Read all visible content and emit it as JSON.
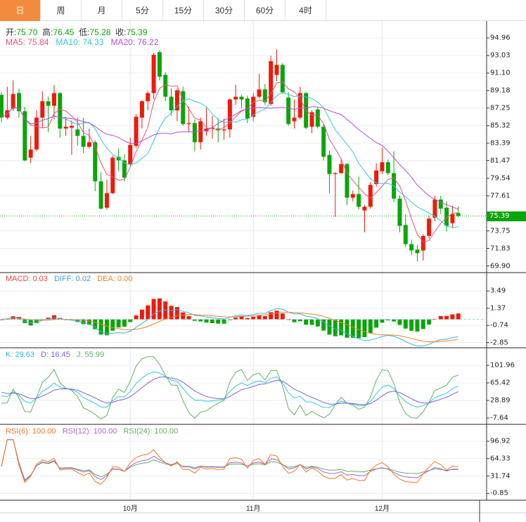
{
  "tabs": [
    "日",
    "周",
    "月",
    "5分",
    "15分",
    "30分",
    "60分",
    "4时"
  ],
  "active_tab": 0,
  "quote": {
    "open_label": "开:",
    "open": "75.70",
    "high_label": "高:",
    "high": "76.45",
    "low_label": "低:",
    "low": "75.28",
    "close_label": "收:",
    "close": "75.39"
  },
  "ma": {
    "ma5": "MA5: 75.84",
    "ma10": "MA10: 74.33",
    "ma20": "MA20: 76.22"
  },
  "macd": {
    "macd": "MACD: 0.03",
    "diff": "DIFF: 0.02",
    "dea": "DEA: 0.00"
  },
  "kdj": {
    "k": "K: 29.63",
    "d": "D: 16.45",
    "j": "J: 55.99"
  },
  "rsi": {
    "rsi6": "RSI(6): 100.00",
    "rsi12": "RSI(12): 100.00",
    "rsi24": "RSI(24): 100.00"
  },
  "current_price": "75.39",
  "colors": {
    "up": "#f0190a",
    "down": "#0aa50a",
    "ma5": "#f0507a",
    "ma10": "#2fc8dc",
    "ma20": "#b050d0",
    "tab_active": "#f28c3c"
  },
  "chart_data": {
    "type": "candlestick",
    "x_ticks": [
      {
        "label": "10月",
        "index": 22
      },
      {
        "label": "11月",
        "index": 43
      },
      {
        "label": "12月",
        "index": 65
      }
    ],
    "price_axis": {
      "ticks": [
        "94.96",
        "93.03",
        "91.10",
        "89.18",
        "87.25",
        "85.32",
        "83.39",
        "81.47",
        "79.54",
        "77.61",
        "73.75",
        "71.83",
        "69.90"
      ],
      "range": [
        69.9,
        94.96
      ]
    },
    "macd_axis": {
      "ticks": [
        "3.49",
        "1.37",
        "-0.74",
        "-2.85"
      ],
      "range": [
        -2.85,
        3.49
      ]
    },
    "kdj_axis": {
      "ticks": [
        "101.96",
        "65.42",
        "28.89",
        "-7.64"
      ],
      "range": [
        -7.64,
        101.96
      ]
    },
    "rsi_axis": {
      "ticks": [
        "96.92",
        "64.33",
        "31.74",
        "-0.85"
      ],
      "range": [
        -0.85,
        96.92
      ]
    },
    "candles_ochl_fields": [
      "open",
      "close",
      "high",
      "low"
    ],
    "candles": [
      [
        88.7,
        86.2,
        89.0,
        85.7
      ],
      [
        86.2,
        87.0,
        89.6,
        86.0
      ],
      [
        87.2,
        88.8,
        90.3,
        86.9
      ],
      [
        88.9,
        86.9,
        89.4,
        86.2
      ],
      [
        86.9,
        81.5,
        87.4,
        81.4
      ],
      [
        81.8,
        82.7,
        84.2,
        81.2
      ],
      [
        82.7,
        86.2,
        87.0,
        82.5
      ],
      [
        86.2,
        88.0,
        89.1,
        85.1
      ],
      [
        88.0,
        87.5,
        88.5,
        84.6
      ],
      [
        87.5,
        88.9,
        89.8,
        86.0
      ],
      [
        88.9,
        85.0,
        89.0,
        84.0
      ],
      [
        85.0,
        85.2,
        86.3,
        84.2
      ],
      [
        85.1,
        85.3,
        85.9,
        82.1
      ],
      [
        84.9,
        84.2,
        86.2,
        83.1
      ],
      [
        84.2,
        83.0,
        86.2,
        82.3
      ],
      [
        83.0,
        83.5,
        85.0,
        82.8
      ],
      [
        83.5,
        79.2,
        83.7,
        78.1
      ],
      [
        79.2,
        76.2,
        80.2,
        76.1
      ],
      [
        76.3,
        77.9,
        79.4,
        76.1
      ],
      [
        77.9,
        81.8,
        82.0,
        77.8
      ],
      [
        81.9,
        81.5,
        82.8,
        80.3
      ],
      [
        81.5,
        79.6,
        82.2,
        79.2
      ],
      [
        81.1,
        83.2,
        84.0,
        80.9
      ],
      [
        83.1,
        86.3,
        86.6,
        82.9
      ],
      [
        86.2,
        88.0,
        88.1,
        85.0
      ],
      [
        88.0,
        88.9,
        89.1,
        87.0
      ],
      [
        88.9,
        93.1,
        93.3,
        88.2
      ],
      [
        93.4,
        90.7,
        93.6,
        90.3
      ],
      [
        90.9,
        88.5,
        91.2,
        88.0
      ],
      [
        88.5,
        87.0,
        89.4,
        86.4
      ],
      [
        87.0,
        89.2,
        89.4,
        85.8
      ],
      [
        89.1,
        85.5,
        89.6,
        85.3
      ],
      [
        85.5,
        85.6,
        87.4,
        84.6
      ],
      [
        85.6,
        83.5,
        86.0,
        82.5
      ],
      [
        83.5,
        85.8,
        86.2,
        82.7
      ],
      [
        84.7,
        85.0,
        87.3,
        84.2
      ],
      [
        85.0,
        85.1,
        86.4,
        83.9
      ],
      [
        85.0,
        84.8,
        86.1,
        83.5
      ],
      [
        84.8,
        84.9,
        86.1,
        83.8
      ],
      [
        84.9,
        88.2,
        88.3,
        84.0
      ],
      [
        88.2,
        88.5,
        89.8,
        87.6
      ],
      [
        88.5,
        88.2,
        88.7,
        87.2
      ],
      [
        88.3,
        86.1,
        88.6,
        85.6
      ],
      [
        86.3,
        88.5,
        88.9,
        85.8
      ],
      [
        88.5,
        89.3,
        91.0,
        88.3
      ],
      [
        89.3,
        87.9,
        89.9,
        87.6
      ],
      [
        87.7,
        92.4,
        93.0,
        87.5
      ],
      [
        90.9,
        92.0,
        93.7,
        90.2
      ],
      [
        92.0,
        89.0,
        92.2,
        88.8
      ],
      [
        88.4,
        85.5,
        89.0,
        85.3
      ],
      [
        85.8,
        86.2,
        88.2,
        85.0
      ],
      [
        86.2,
        88.9,
        89.6,
        86.0
      ],
      [
        88.9,
        85.1,
        89.0,
        84.9
      ],
      [
        85.2,
        86.8,
        87.0,
        84.5
      ],
      [
        87.1,
        85.2,
        87.3,
        85.0
      ],
      [
        85.2,
        81.9,
        85.5,
        81.5
      ],
      [
        82.1,
        80.0,
        82.6,
        77.9
      ],
      [
        80.0,
        80.1,
        80.2,
        75.3
      ],
      [
        80.1,
        81.1,
        81.7,
        80.0
      ],
      [
        81.1,
        77.4,
        81.2,
        76.6
      ],
      [
        77.4,
        77.8,
        78.2,
        77.0
      ],
      [
        77.8,
        76.4,
        79.7,
        76.1
      ],
      [
        76.0,
        76.4,
        76.6,
        73.6
      ],
      [
        76.4,
        78.8,
        79.1,
        76.2
      ],
      [
        78.9,
        80.4,
        81.2,
        78.6
      ],
      [
        80.3,
        81.3,
        82.9,
        80.0
      ],
      [
        81.3,
        80.1,
        81.6,
        79.9
      ],
      [
        80.1,
        77.3,
        82.5,
        76.9
      ],
      [
        77.3,
        74.3,
        77.7,
        73.6
      ],
      [
        74.4,
        72.3,
        75.6,
        72.0
      ],
      [
        72.3,
        71.6,
        72.8,
        71.1
      ],
      [
        71.7,
        71.3,
        72.2,
        70.4
      ],
      [
        71.6,
        73.2,
        73.4,
        70.5
      ],
      [
        73.2,
        75.1,
        75.4,
        72.9
      ],
      [
        75.2,
        77.2,
        77.6,
        74.8
      ],
      [
        77.2,
        76.2,
        77.6,
        75.6
      ],
      [
        76.3,
        74.3,
        77.0,
        73.7
      ],
      [
        74.6,
        75.6,
        76.5,
        74.1
      ],
      [
        75.7,
        75.39,
        76.45,
        75.28
      ]
    ]
  }
}
